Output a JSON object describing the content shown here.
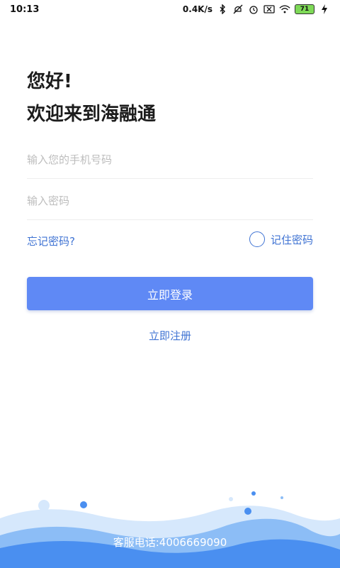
{
  "status_bar": {
    "time": "10:13",
    "speed": "0.4K/s",
    "battery": "71",
    "icons": [
      "bluetooth-icon",
      "mute-icon",
      "alarm-icon",
      "sim-off-icon",
      "wifi-icon",
      "battery-icon",
      "charging-icon"
    ]
  },
  "greeting": {
    "line1": "您好!",
    "line2": "欢迎来到海融通"
  },
  "form": {
    "phone_placeholder": "输入您的手机号码",
    "password_placeholder": "输入密码",
    "forgot_label": "忘记密码?",
    "remember_label": "记住密码",
    "login_label": "立即登录",
    "register_label": "立即注册"
  },
  "footer": {
    "hotline": "客服电话:4006669090"
  },
  "colors": {
    "accent": "#3f73d3",
    "button": "#5f89f5",
    "wave_dark": "#4a8ff0",
    "wave_light": "#cfe4fb"
  }
}
